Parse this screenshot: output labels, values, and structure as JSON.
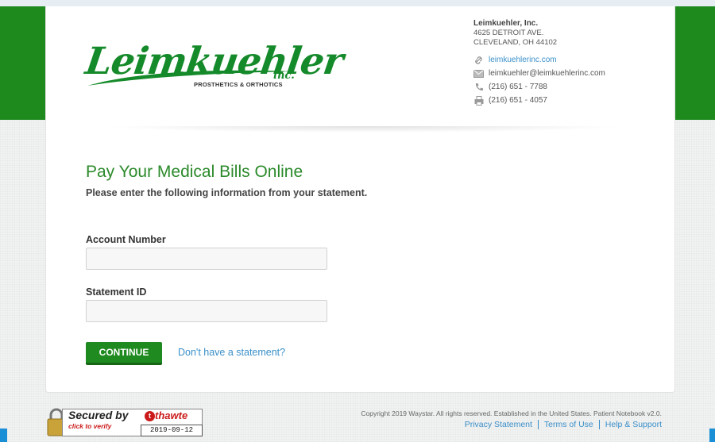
{
  "brand": {
    "logo_word": "Leimkuehler",
    "logo_inc": "inc.",
    "logo_tagline": "PROSTHETICS & ORTHOTICS",
    "green": "#1e8a1e"
  },
  "contact": {
    "company": "Leimkuehler, Inc.",
    "address_line1": "4625 DETROIT AVE.",
    "address_line2": "CLEVELAND, OH 44102",
    "website": "leimkuehlerinc.com",
    "email": "leimkuehler@leimkuehlerinc.com",
    "phone": "(216) 651 - 7788",
    "fax": "(216) 651 - 4057",
    "icons": [
      "link-icon",
      "envelope-icon",
      "phone-icon",
      "fax-icon"
    ]
  },
  "form": {
    "title": "Pay Your Medical Bills Online",
    "subtitle": "Please enter the following information from your statement.",
    "account_label": "Account Number",
    "account_value": "",
    "statement_label": "Statement ID",
    "statement_value": "",
    "continue_label": "CONTINUE",
    "no_statement_link": "Don't have a statement?"
  },
  "seal": {
    "secured_by": "Secured by",
    "thawte": "thawte",
    "click": "click to verify",
    "date": "2019-09-12"
  },
  "footer": {
    "copyright": "Copyright 2019 Waystar. All rights reserved. Established in the United States. Patient Notebook v2.0.",
    "links": [
      "Privacy Statement",
      "Terms of Use",
      "Help & Support"
    ]
  }
}
